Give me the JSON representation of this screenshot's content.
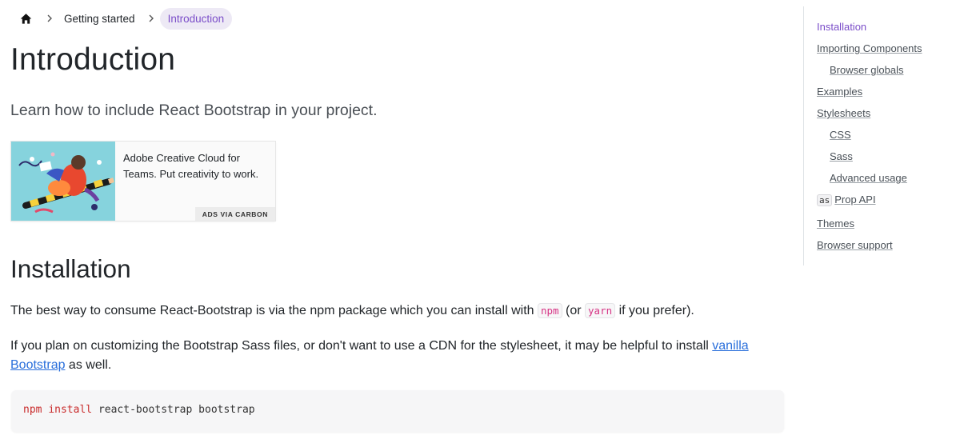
{
  "breadcrumb": {
    "home_icon": "home-icon",
    "separator_icon": "chevron-right-icon",
    "items": [
      {
        "label": "Getting started"
      },
      {
        "label": "Introduction"
      }
    ]
  },
  "page": {
    "title": "Introduction",
    "lead": "Learn how to include React Bootstrap in your project."
  },
  "ad": {
    "text": "Adobe Creative Cloud for Teams. Put creativity to work.",
    "via_label": "ADS VIA CARBON"
  },
  "installation": {
    "heading": "Installation",
    "p1": {
      "before": "The best way to consume React-Bootstrap is via the npm package which you can install with ",
      "code1": "npm",
      "middle": " (or ",
      "code2": "yarn",
      "after": " if you prefer)."
    },
    "p2": {
      "before": "If you plan on customizing the Bootstrap Sass files, or don't want to use a CDN for the stylesheet, it may be helpful to install ",
      "link": "vanilla Bootstrap",
      "after": " as well."
    },
    "code_block": {
      "cmd": "npm",
      "sub": "install",
      "args": "react-bootstrap bootstrap"
    }
  },
  "toc": {
    "items": [
      {
        "label": "Installation",
        "level": 1,
        "active": true
      },
      {
        "label": "Importing Components",
        "level": 1
      },
      {
        "label": "Browser globals",
        "level": 2
      },
      {
        "label": "Examples",
        "level": 1
      },
      {
        "label": "Stylesheets",
        "level": 1
      },
      {
        "label": "CSS",
        "level": 2
      },
      {
        "label": "Sass",
        "level": 2
      },
      {
        "label": "Advanced usage",
        "level": 2
      },
      {
        "label": "Prop API",
        "level": 1,
        "code": "as"
      },
      {
        "label": "Themes",
        "level": 1
      },
      {
        "label": "Browser support",
        "level": 1
      }
    ]
  },
  "colors": {
    "accent": "#7b4ec9",
    "link": "#2a6fdb",
    "inline_code": "#d63384",
    "keyword": "#c92c2c"
  }
}
